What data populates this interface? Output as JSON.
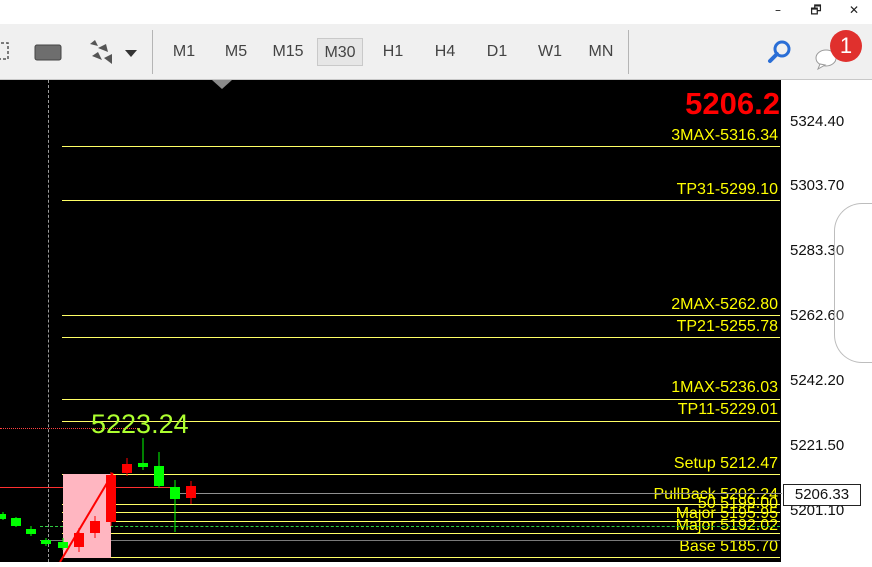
{
  "window": {
    "minimize": "–",
    "restore": "🗗",
    "close": "✕"
  },
  "toolbar": {
    "timeframes": [
      "M1",
      "M5",
      "M15",
      "M30",
      "H1",
      "H4",
      "D1",
      "W1",
      "MN"
    ],
    "active_timeframe": "M30",
    "notification_count": "1"
  },
  "chart": {
    "current_price_large": "5206.2",
    "peak_label": "5223.24",
    "current_price_tag": "5206.33",
    "price_axis": [
      "5324.40",
      "5303.70",
      "5283.30",
      "5262.60",
      "5242.20",
      "5221.50",
      "5201.10"
    ],
    "levels": [
      {
        "label": "3MAX-5316.34",
        "color": "#ffff00"
      },
      {
        "label": "TP31-5299.10",
        "color": "#ffff00"
      },
      {
        "label": "2MAX-5262.80",
        "color": "#ffff00"
      },
      {
        "label": "TP21-5255.78",
        "color": "#ffff00"
      },
      {
        "label": "1MAX-5236.03",
        "color": "#ffff00"
      },
      {
        "label": "TP11-5229.01",
        "color": "#ffff00"
      },
      {
        "label": "Setup 5212.47",
        "color": "#ffff00"
      },
      {
        "label": "PullBack 5202.24",
        "color": "#ffff00"
      },
      {
        "label": "50 5199.00",
        "color": "#ffff00"
      },
      {
        "label": "Major 5195.95",
        "color": "#ffff00"
      },
      {
        "label": "Major 5192.02",
        "color": "#ffff00"
      },
      {
        "label": "Base 5185.70",
        "color": "#ffff00"
      }
    ],
    "colors": {
      "bull": "#00ff00",
      "bear": "#ff0000",
      "level": "#ffff00",
      "big_price": "#ff0000",
      "peak": "#adff2f"
    }
  }
}
